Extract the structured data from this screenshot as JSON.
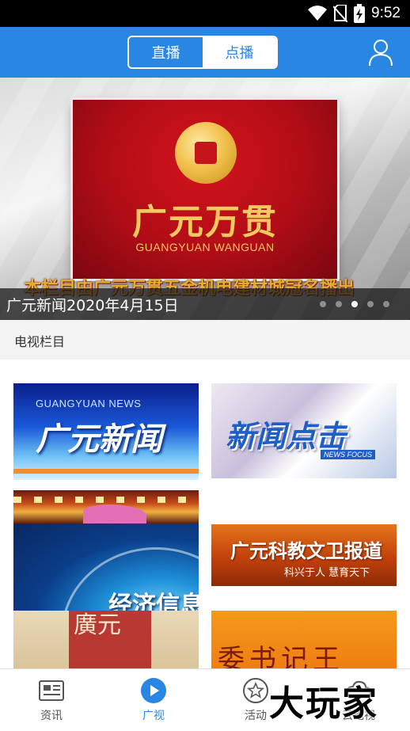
{
  "status_bar": {
    "time": "9:52",
    "icons": [
      "wifi-icon",
      "no-sim-icon",
      "battery-charging-icon"
    ]
  },
  "header": {
    "tabs": [
      {
        "label": "直播",
        "selected": true
      },
      {
        "label": "点播",
        "selected": false
      }
    ],
    "user_icon": "user-icon",
    "accent_color": "#2a86e3"
  },
  "banner": {
    "caption": "广元新闻2020年4月15日",
    "brand_title": "广元万贯",
    "brand_subtitle": "GUANGYUAN WANGUAN",
    "scroll_text": "本栏目由广元万贯五金机电建材城冠名播出",
    "pager": {
      "count": 5,
      "active_index": 2
    }
  },
  "section": {
    "title": "电视栏目"
  },
  "programs": {
    "news": {
      "en": "GUANGYUAN NEWS",
      "zh": "广元新闻"
    },
    "focus": {
      "zh": "新闻点击",
      "en": "NEWS FOCUS"
    },
    "globe": {
      "zh": "经济信息"
    },
    "culture": {
      "zh": "廣元"
    },
    "edu": {
      "zh": "广元科教文卫报道",
      "sub": "科兴于人 慧育天下"
    },
    "secretary": {
      "zh": "委书记王"
    }
  },
  "bottom_nav": {
    "items": [
      {
        "label": "资讯",
        "icon": "news-icon",
        "active": false
      },
      {
        "label": "广视",
        "icon": "play-icon",
        "active": true
      },
      {
        "label": "活动",
        "icon": "star-icon",
        "active": false
      },
      {
        "label": "云电视",
        "icon": "cloud-tv-icon",
        "active": false
      }
    ]
  },
  "watermark": "大玩家"
}
